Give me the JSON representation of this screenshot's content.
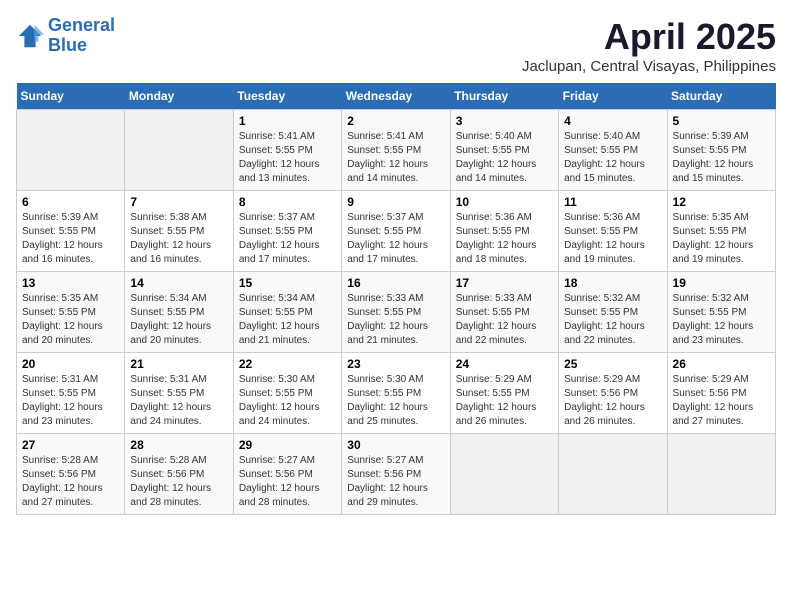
{
  "logo": {
    "line1": "General",
    "line2": "Blue"
  },
  "title": "April 2025",
  "subtitle": "Jaclupan, Central Visayas, Philippines",
  "weekdays": [
    "Sunday",
    "Monday",
    "Tuesday",
    "Wednesday",
    "Thursday",
    "Friday",
    "Saturday"
  ],
  "weeks": [
    [
      {
        "num": "",
        "info": ""
      },
      {
        "num": "",
        "info": ""
      },
      {
        "num": "1",
        "info": "Sunrise: 5:41 AM\nSunset: 5:55 PM\nDaylight: 12 hours\nand 13 minutes."
      },
      {
        "num": "2",
        "info": "Sunrise: 5:41 AM\nSunset: 5:55 PM\nDaylight: 12 hours\nand 14 minutes."
      },
      {
        "num": "3",
        "info": "Sunrise: 5:40 AM\nSunset: 5:55 PM\nDaylight: 12 hours\nand 14 minutes."
      },
      {
        "num": "4",
        "info": "Sunrise: 5:40 AM\nSunset: 5:55 PM\nDaylight: 12 hours\nand 15 minutes."
      },
      {
        "num": "5",
        "info": "Sunrise: 5:39 AM\nSunset: 5:55 PM\nDaylight: 12 hours\nand 15 minutes."
      }
    ],
    [
      {
        "num": "6",
        "info": "Sunrise: 5:39 AM\nSunset: 5:55 PM\nDaylight: 12 hours\nand 16 minutes."
      },
      {
        "num": "7",
        "info": "Sunrise: 5:38 AM\nSunset: 5:55 PM\nDaylight: 12 hours\nand 16 minutes."
      },
      {
        "num": "8",
        "info": "Sunrise: 5:37 AM\nSunset: 5:55 PM\nDaylight: 12 hours\nand 17 minutes."
      },
      {
        "num": "9",
        "info": "Sunrise: 5:37 AM\nSunset: 5:55 PM\nDaylight: 12 hours\nand 17 minutes."
      },
      {
        "num": "10",
        "info": "Sunrise: 5:36 AM\nSunset: 5:55 PM\nDaylight: 12 hours\nand 18 minutes."
      },
      {
        "num": "11",
        "info": "Sunrise: 5:36 AM\nSunset: 5:55 PM\nDaylight: 12 hours\nand 19 minutes."
      },
      {
        "num": "12",
        "info": "Sunrise: 5:35 AM\nSunset: 5:55 PM\nDaylight: 12 hours\nand 19 minutes."
      }
    ],
    [
      {
        "num": "13",
        "info": "Sunrise: 5:35 AM\nSunset: 5:55 PM\nDaylight: 12 hours\nand 20 minutes."
      },
      {
        "num": "14",
        "info": "Sunrise: 5:34 AM\nSunset: 5:55 PM\nDaylight: 12 hours\nand 20 minutes."
      },
      {
        "num": "15",
        "info": "Sunrise: 5:34 AM\nSunset: 5:55 PM\nDaylight: 12 hours\nand 21 minutes."
      },
      {
        "num": "16",
        "info": "Sunrise: 5:33 AM\nSunset: 5:55 PM\nDaylight: 12 hours\nand 21 minutes."
      },
      {
        "num": "17",
        "info": "Sunrise: 5:33 AM\nSunset: 5:55 PM\nDaylight: 12 hours\nand 22 minutes."
      },
      {
        "num": "18",
        "info": "Sunrise: 5:32 AM\nSunset: 5:55 PM\nDaylight: 12 hours\nand 22 minutes."
      },
      {
        "num": "19",
        "info": "Sunrise: 5:32 AM\nSunset: 5:55 PM\nDaylight: 12 hours\nand 23 minutes."
      }
    ],
    [
      {
        "num": "20",
        "info": "Sunrise: 5:31 AM\nSunset: 5:55 PM\nDaylight: 12 hours\nand 23 minutes."
      },
      {
        "num": "21",
        "info": "Sunrise: 5:31 AM\nSunset: 5:55 PM\nDaylight: 12 hours\nand 24 minutes."
      },
      {
        "num": "22",
        "info": "Sunrise: 5:30 AM\nSunset: 5:55 PM\nDaylight: 12 hours\nand 24 minutes."
      },
      {
        "num": "23",
        "info": "Sunrise: 5:30 AM\nSunset: 5:55 PM\nDaylight: 12 hours\nand 25 minutes."
      },
      {
        "num": "24",
        "info": "Sunrise: 5:29 AM\nSunset: 5:55 PM\nDaylight: 12 hours\nand 26 minutes."
      },
      {
        "num": "25",
        "info": "Sunrise: 5:29 AM\nSunset: 5:56 PM\nDaylight: 12 hours\nand 26 minutes."
      },
      {
        "num": "26",
        "info": "Sunrise: 5:29 AM\nSunset: 5:56 PM\nDaylight: 12 hours\nand 27 minutes."
      }
    ],
    [
      {
        "num": "27",
        "info": "Sunrise: 5:28 AM\nSunset: 5:56 PM\nDaylight: 12 hours\nand 27 minutes."
      },
      {
        "num": "28",
        "info": "Sunrise: 5:28 AM\nSunset: 5:56 PM\nDaylight: 12 hours\nand 28 minutes."
      },
      {
        "num": "29",
        "info": "Sunrise: 5:27 AM\nSunset: 5:56 PM\nDaylight: 12 hours\nand 28 minutes."
      },
      {
        "num": "30",
        "info": "Sunrise: 5:27 AM\nSunset: 5:56 PM\nDaylight: 12 hours\nand 29 minutes."
      },
      {
        "num": "",
        "info": ""
      },
      {
        "num": "",
        "info": ""
      },
      {
        "num": "",
        "info": ""
      }
    ]
  ]
}
